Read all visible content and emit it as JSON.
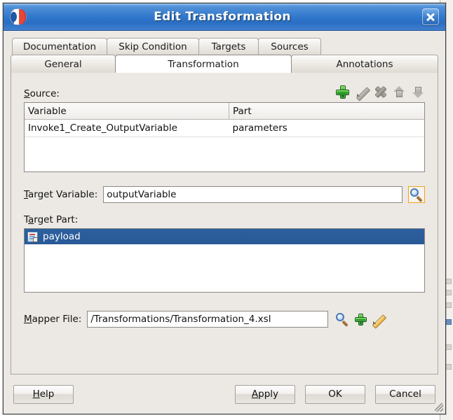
{
  "window": {
    "title": "Edit Transformation",
    "app_icon": "jdeveloper-logo-icon",
    "close_icon": "close-icon"
  },
  "tabs": {
    "row1": [
      {
        "label": "Documentation",
        "active": false
      },
      {
        "label": "Skip Condition",
        "active": false
      },
      {
        "label": "Targets",
        "active": false
      },
      {
        "label": "Sources",
        "active": false
      }
    ],
    "row2": [
      {
        "label": "General",
        "active": false
      },
      {
        "label": "Transformation",
        "active": true
      },
      {
        "label": "Annotations",
        "active": false
      }
    ]
  },
  "panel": {
    "source": {
      "label": "Source:",
      "label_mnemonic": "S",
      "toolbar": [
        {
          "name": "add-source-button",
          "icon": "plus-icon",
          "enabled": true
        },
        {
          "name": "edit-source-button",
          "icon": "pencil-icon",
          "enabled": false
        },
        {
          "name": "delete-source-button",
          "icon": "delete-x-icon",
          "enabled": false
        },
        {
          "name": "move-up-button",
          "icon": "arrow-up-icon",
          "enabled": false
        },
        {
          "name": "move-down-button",
          "icon": "arrow-down-icon",
          "enabled": false
        }
      ],
      "columns": [
        "Variable",
        "Part"
      ],
      "rows": [
        {
          "variable": "Invoke1_Create_OutputVariable",
          "part": "parameters"
        }
      ]
    },
    "target_variable": {
      "label": "Target Variable:",
      "label_mnemonic": "T",
      "value": "outputVariable",
      "browse_icon": "magnifier-icon",
      "browse_focused": true
    },
    "target_part": {
      "label": "Target Part:",
      "label_mnemonic": "a",
      "items": [
        {
          "label": "payload",
          "icon": "document-part-icon",
          "selected": true
        }
      ]
    },
    "mapper_file": {
      "label": "Mapper File:",
      "label_mnemonic": "M",
      "value": "/Transformations/Transformation_4.xsl",
      "actions": [
        {
          "name": "browse-mapper-button",
          "icon": "magnifier-icon"
        },
        {
          "name": "create-mapper-button",
          "icon": "plus-icon"
        },
        {
          "name": "edit-mapper-button",
          "icon": "pencil-icon"
        }
      ]
    }
  },
  "buttons": {
    "help": "Help",
    "help_mnemonic": "H",
    "apply": "Apply",
    "apply_mnemonic": "A",
    "ok": "OK",
    "cancel": "Cancel"
  },
  "colors": {
    "titlebar_blue": "#2f77cc",
    "selection_blue": "#2c5f9e",
    "dialog_bg": "#ece9e4",
    "focus_orange": "#e8a32a",
    "plus_green": "#1f9e1f"
  }
}
